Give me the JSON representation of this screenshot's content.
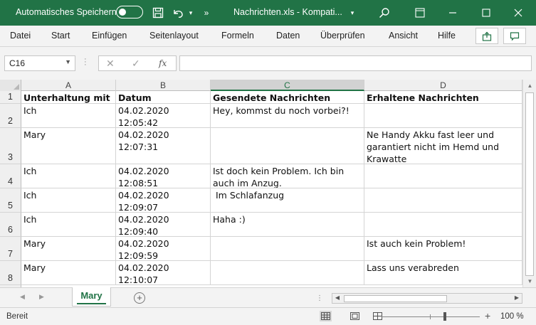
{
  "titlebar": {
    "autosave_label": "Automatisches Speichern",
    "filename": "Nachrichten.xls  -  Kompati...",
    "accent": "#217346"
  },
  "ribbon": {
    "tabs": [
      "Datei",
      "Start",
      "Einfügen",
      "Seitenlayout",
      "Formeln",
      "Daten",
      "Überprüfen",
      "Ansicht",
      "Hilfe"
    ]
  },
  "formula_bar": {
    "name_box": "C16",
    "fx_label": "fx",
    "content": ""
  },
  "grid": {
    "columns": [
      "A",
      "B",
      "C",
      "D"
    ],
    "selected_column": "C",
    "rows": [
      {
        "num": "1",
        "cells": [
          "Unterhaltung mit",
          "Datum",
          "Gesendete Nachrichten",
          "Erhaltene Nachrichten"
        ]
      },
      {
        "num": "2",
        "cells": [
          "Ich",
          "04.02.2020\n12:05:42",
          "Hey, kommst du noch vorbei?!",
          ""
        ]
      },
      {
        "num": "3",
        "cells": [
          "Mary",
          "04.02.2020\n12:07:31",
          "",
          "Ne Handy Akku fast leer und garantiert nicht im Hemd und Krawatte"
        ]
      },
      {
        "num": "4",
        "cells": [
          "Ich",
          "04.02.2020\n12:08:51",
          "Ist doch kein Problem. Ich bin auch im Anzug.",
          ""
        ]
      },
      {
        "num": "5",
        "cells": [
          "Ich",
          "04.02.2020\n12:09:07",
          " Im Schlafanzug",
          ""
        ]
      },
      {
        "num": "6",
        "cells": [
          "Ich",
          "04.02.2020\n12:09:40",
          "Haha :)",
          ""
        ]
      },
      {
        "num": "7",
        "cells": [
          "Mary",
          "04.02.2020\n12:09:59",
          "",
          "Ist auch kein Problem!"
        ]
      },
      {
        "num": "8",
        "cells": [
          "Mary",
          "04.02.2020\n12:10:07",
          "",
          "Lass uns verabreden"
        ]
      }
    ]
  },
  "sheets": {
    "active": "Mary"
  },
  "status": {
    "text": "Bereit",
    "zoom": "100 %",
    "zoom_minus": "−",
    "zoom_plus": "+"
  }
}
